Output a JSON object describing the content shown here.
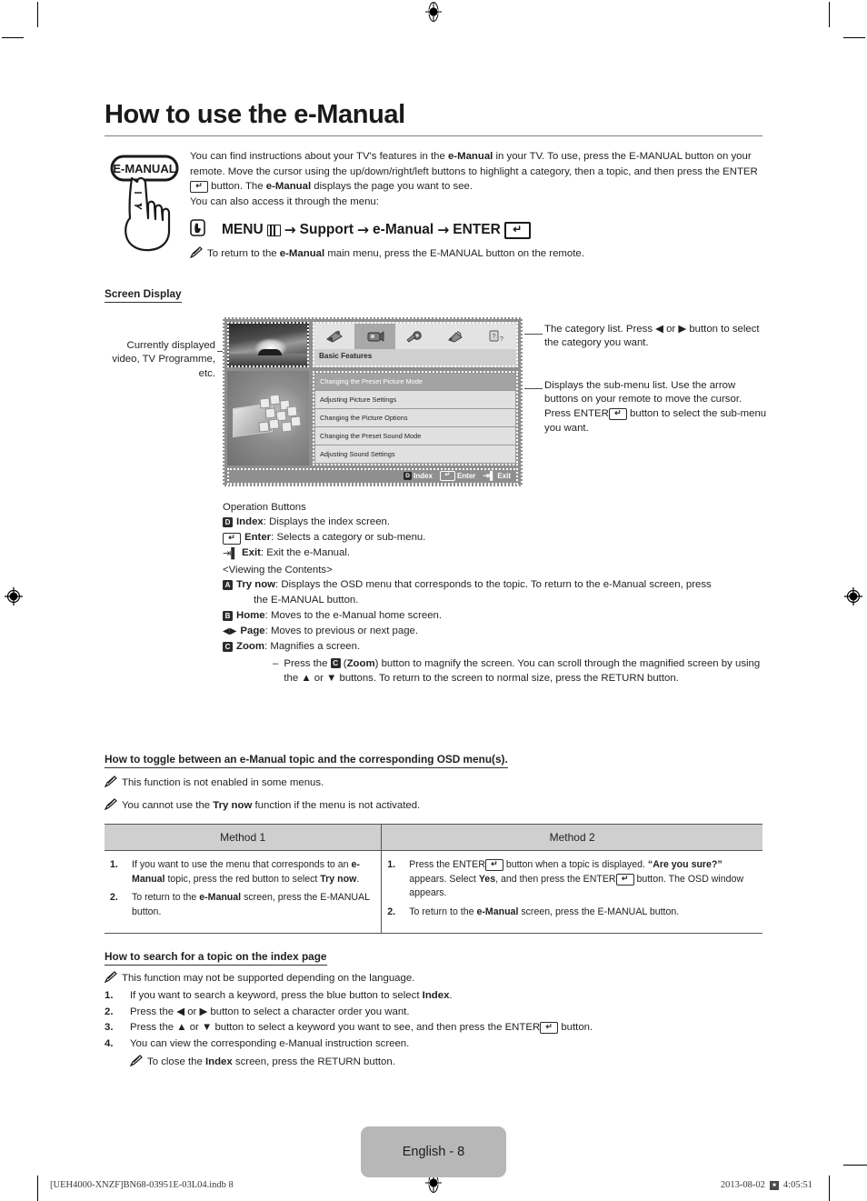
{
  "title": "How to use the e-Manual",
  "intro": {
    "remote_label": "E-MANUAL",
    "p1_a": "You can find instructions about your TV's features in the ",
    "p1_b": "e-Manual",
    "p1_c": " in your TV. To use, press the E-MANUAL button on your remote. Move the cursor using the up/down/right/left buttons to highlight a category, then a topic, and then press the ENTER",
    "p1_d": " button. The ",
    "p1_e": "e-Manual",
    "p1_f": " displays the page you want to see.",
    "p2": "You can also access it through the menu:",
    "menu_path": {
      "menu": "MENU",
      "arrow1": "→",
      "support": "Support",
      "arrow2": "→",
      "emanual": "e-Manual",
      "arrow3": "→",
      "enter": "ENTER"
    },
    "note_a": "To return to the ",
    "note_b": "e-Manual",
    "note_c": " main menu, press the E-MANUAL button on the remote."
  },
  "screen_display": {
    "heading": "Screen Display",
    "caption_left": "Currently displayed video, TV Programme, etc.",
    "caption_right_1": "The category list. Press ◀ or ▶ button to select the category you want.",
    "caption_right_2_a": "Displays the sub-menu list. Use the arrow buttons on your remote to move the cursor. Press ENTER",
    "caption_right_2_b": " button to select the sub-menu you want.",
    "tv": {
      "category_title": "Basic Features",
      "categories": [
        "channel-icon",
        "picture-icon",
        "settings-icon",
        "network-icon",
        "support-icon"
      ],
      "selected_category_index": 1,
      "submenu": [
        "Changing the Preset Picture Mode",
        "Adjusting Picture Settings",
        "Changing the Picture Options",
        "Changing the Preset Sound Mode",
        "Adjusting Sound Settings"
      ],
      "highlighted_submenu_index": 0,
      "opbar": [
        "Index",
        "Enter",
        "Exit"
      ]
    }
  },
  "operation_buttons": {
    "heading": "Operation Buttons",
    "items": [
      {
        "glyph": "D",
        "glyph_type": "kbox",
        "name": "Index",
        "text": ": Displays the index screen."
      },
      {
        "glyph": "ENTER",
        "glyph_type": "kenter",
        "name": "Enter",
        "text": ": Selects a category or sub-menu."
      },
      {
        "glyph": "EXIT",
        "glyph_type": "kexit",
        "name": "Exit",
        "text": ": Exit the e-Manual."
      }
    ],
    "viewing_heading": "<Viewing the Contents>",
    "try_now": {
      "glyph": "A",
      "name": "Try now",
      "text_line1": ": Displays the OSD menu that corresponds to the topic. To return to the e-Manual screen, press",
      "text_line2": "the E-MANUAL button."
    },
    "home": {
      "glyph": "B",
      "name": "Home",
      "text": ": Moves to the e-Manual home screen."
    },
    "page": {
      "glyph": "◀▶",
      "name": "Page",
      "text": ": Moves to previous or next page."
    },
    "zoom": {
      "glyph": "C",
      "name": "Zoom",
      "text": ": Magnifies a screen."
    },
    "zoom_detail_a": "Press the ",
    "zoom_detail_b": "C",
    "zoom_detail_c": " (",
    "zoom_detail_d": "Zoom",
    "zoom_detail_e": ") button to magnify the screen. You can scroll through the magnified screen by using the ▲ or ▼ buttons. To return to the screen to normal size, press the RETURN button."
  },
  "toggle_section": {
    "heading": "How to toggle between an e-Manual topic and the corresponding OSD menu(s).",
    "note1": "This function is not enabled in some menus.",
    "note2_a": "You cannot use the ",
    "note2_b": "Try now",
    "note2_c": " function if the menu is not activated.",
    "table": {
      "headers": [
        "Method 1",
        "Method 2"
      ],
      "method1": [
        {
          "n": "1.",
          "parts": [
            "If you want to use the menu that corresponds to an ",
            "e-Manual",
            " topic, press the red button to select ",
            "Try now",
            "."
          ]
        },
        {
          "n": "2.",
          "parts": [
            "To return to the ",
            "e-Manual",
            " screen, press the E-MANUAL button."
          ]
        }
      ],
      "method2": [
        {
          "n": "1.",
          "parts": [
            "Press the ENTER",
            " button when a topic is displayed. ",
            "“Are you sure?”",
            " appears. Select ",
            "Yes",
            ", and then press the ENTER",
            " button. The OSD window appears."
          ]
        },
        {
          "n": "2.",
          "parts": [
            "To return to the ",
            "e-Manual",
            " screen, press the E-MANUAL button."
          ]
        }
      ]
    }
  },
  "index_section": {
    "heading": "How to search for a topic on the index page",
    "note": "This function may not be supported depending on the language.",
    "steps": [
      {
        "n": "1.",
        "a": "If you want to search a keyword, press the blue button to select ",
        "b": "Index",
        "c": "."
      },
      {
        "n": "2.",
        "a": "Press the ◀ or ▶ button to select a character order you want.",
        "b": "",
        "c": ""
      },
      {
        "n": "3.",
        "a": "Press the ▲ or ▼ button to select a keyword you want to see, and then press the ENTER",
        "b": "",
        "c": " button."
      },
      {
        "n": "4.",
        "a": "You can view the corresponding e-Manual instruction screen.",
        "b": "",
        "c": ""
      }
    ],
    "closing_note_a": "To close the ",
    "closing_note_b": "Index",
    "closing_note_c": " screen, press the RETURN button."
  },
  "footer": {
    "page_label": "English - 8",
    "file_ref": "[UEH4000-XNZF]BN68-03951E-03L04.indb   8",
    "date": "2013-08-02",
    "time": "4:05:51"
  }
}
